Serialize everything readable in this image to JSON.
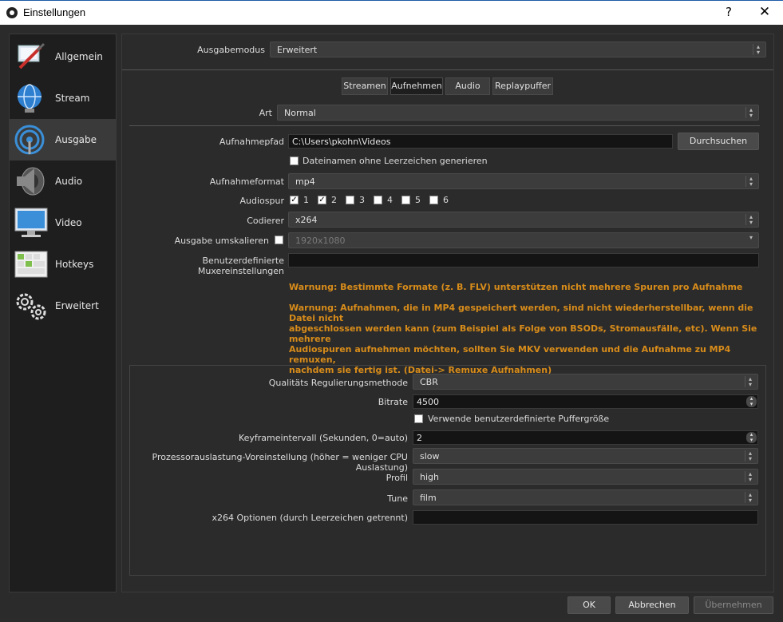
{
  "window": {
    "title": "Einstellungen",
    "help": "?",
    "close": "✕"
  },
  "sidebar": {
    "items": [
      {
        "label": "Allgemein"
      },
      {
        "label": "Stream"
      },
      {
        "label": "Ausgabe"
      },
      {
        "label": "Audio"
      },
      {
        "label": "Video"
      },
      {
        "label": "Hotkeys"
      },
      {
        "label": "Erweitert"
      }
    ]
  },
  "output_mode": {
    "label": "Ausgabemodus",
    "value": "Erweitert"
  },
  "tabs": [
    {
      "label": "Streamen"
    },
    {
      "label": "Aufnehmen",
      "active": true
    },
    {
      "label": "Audio"
    },
    {
      "label": "Replaypuffer"
    }
  ],
  "recording": {
    "type_label": "Art",
    "type_value": "Normal",
    "path_label": "Aufnahmepfad",
    "path_value": "C:\\Users\\pkohn\\Videos",
    "browse_label": "Durchsuchen",
    "no_space_label": "Dateinamen ohne Leerzeichen generieren",
    "format_label": "Aufnahmeformat",
    "format_value": "mp4",
    "audio_track_label": "Audiospur",
    "tracks": [
      {
        "num": "1",
        "checked": true
      },
      {
        "num": "2",
        "checked": true
      },
      {
        "num": "3",
        "checked": false
      },
      {
        "num": "4",
        "checked": false
      },
      {
        "num": "5",
        "checked": false
      },
      {
        "num": "6",
        "checked": false
      }
    ],
    "encoder_label": "Codierer",
    "encoder_value": "x264",
    "rescale_label": "Ausgabe umskalieren",
    "rescale_value": "1920x1080",
    "muxer_label": "Benutzerdefinierte Muxereinstellungen",
    "muxer_value": "",
    "warning1": "Warnung: Bestimmte Formate (z. B. FLV) unterstützen nicht mehrere Spuren pro Aufnahme",
    "warning2_lines": [
      "Warnung: Aufnahmen, die in MP4 gespeichert werden, sind nicht wiederherstellbar, wenn die Datei nicht",
      "abgeschlossen werden kann (zum Beispiel als Folge von BSODs, Stromausfälle, etc). Wenn Sie mehrere",
      "Audiospuren aufnehmen möchten, sollten Sie MKV verwenden und die Aufnahme zu MP4 remuxen,",
      "nachdem sie fertig ist. (Datei-> Remuxe Aufnahmen)"
    ]
  },
  "encoder_settings": {
    "rate_control_label": "Qualitäts Regulierungsmethode",
    "rate_control_value": "CBR",
    "bitrate_label": "Bitrate",
    "bitrate_value": "4500",
    "custom_buffer_label": "Verwende benutzerdefinierte Puffergröße",
    "keyframe_label": "Keyframeintervall (Sekunden, 0=auto)",
    "keyframe_value": "2",
    "preset_label": "Prozessorauslastung-Voreinstellung (höher = weniger CPU Auslastung)",
    "preset_value": "slow",
    "profile_label": "Profil",
    "profile_value": "high",
    "tune_label": "Tune",
    "tune_value": "film",
    "x264opts_label": "x264 Optionen (durch Leerzeichen getrennt)",
    "x264opts_value": ""
  },
  "footer": {
    "ok": "OK",
    "cancel": "Abbrechen",
    "apply": "Übernehmen"
  }
}
